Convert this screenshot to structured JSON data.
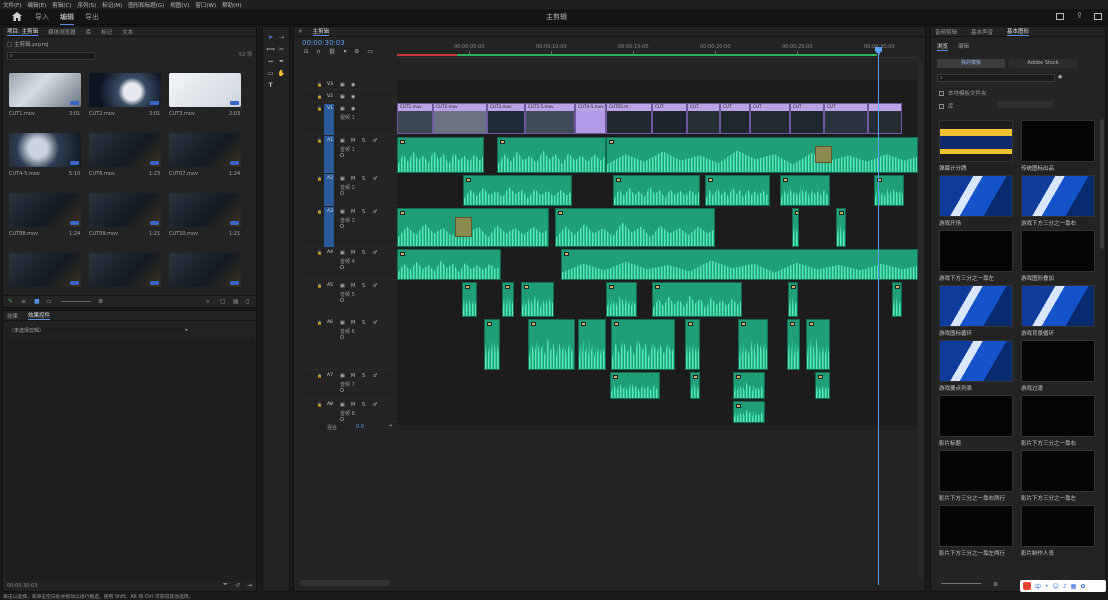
{
  "menu": [
    "文件(F)",
    "编辑(E)",
    "剪辑(C)",
    "序列(S)",
    "标记(M)",
    "图形和标题(G)",
    "视图(V)",
    "窗口(W)",
    "帮助(H)"
  ],
  "workspace": {
    "tabs": [
      "导入",
      "编辑",
      "导出"
    ],
    "active": "编辑",
    "title": "主剪辑"
  },
  "project": {
    "tabs": [
      "项目: 主剪辑",
      "媒体浏览器",
      "库",
      "标记",
      "文本"
    ],
    "file": "主剪辑.prproj",
    "count": "52 项",
    "clips": [
      {
        "name": "CUT1.mov",
        "dur": "3:01",
        "tone": "lightgear"
      },
      {
        "name": "CUT2.mov",
        "dur": "3:01",
        "tone": "globe"
      },
      {
        "name": "CUT3.mov",
        "dur": "2:03",
        "tone": "white"
      },
      {
        "name": "CUT4-5.mov",
        "dur": "5:10",
        "tone": "gear"
      },
      {
        "name": "CUT6.mov",
        "dur": "1:23",
        "tone": "dark"
      },
      {
        "name": "CUT07.mov",
        "dur": "1:24",
        "tone": "dark"
      },
      {
        "name": "CUT08.mov",
        "dur": "1:24",
        "tone": "dark"
      },
      {
        "name": "CUT09.mov",
        "dur": "1:21",
        "tone": "dark"
      },
      {
        "name": "CUT10.mov",
        "dur": "1:21",
        "tone": "dark"
      },
      {
        "name": "",
        "dur": "",
        "tone": "dark"
      },
      {
        "name": "",
        "dur": "",
        "tone": "dark"
      },
      {
        "name": "",
        "dur": "",
        "tone": "dark"
      }
    ]
  },
  "effects": {
    "tabs": [
      "效果",
      "效果控件"
    ],
    "clip_selector": "（未选择剪辑）",
    "timecode": "00:00:30:03"
  },
  "timeline": {
    "tab": "主剪辑",
    "timecode": "00:00:30:03",
    "ruler": [
      "00:00:05:00",
      "00:00:10:00",
      "00:00:15:00",
      "00:00:20:00",
      "00:00:25:00",
      "00:00:30:00"
    ],
    "tracks": {
      "v": [
        {
          "id": "V3"
        },
        {
          "id": "V2"
        },
        {
          "id": "V1",
          "name": "视频 1"
        }
      ],
      "a": [
        {
          "id": "A1",
          "name": "音频 1"
        },
        {
          "id": "A2",
          "name": "音频 2"
        },
        {
          "id": "A3",
          "name": "音频 3"
        },
        {
          "id": "A4",
          "name": "音频 4"
        },
        {
          "id": "A5",
          "name": "音频 5"
        },
        {
          "id": "A6",
          "name": "音频 6"
        },
        {
          "id": "A7",
          "name": "音频 7"
        },
        {
          "id": "A8",
          "name": "音频 8"
        }
      ],
      "mix": "混合",
      "mix_val": "0.0",
      "m": "M",
      "s": "S",
      "o": "O"
    },
    "vclips": [
      "CUT1.mov",
      "CUT2.mov",
      "CUT3.mov",
      "CUT3 5.mov",
      "CUT4-5.mov",
      "CUT05.m",
      "CUT",
      "CUT",
      "CUT",
      "CUT",
      "CUT",
      "CUT"
    ]
  },
  "graphics": {
    "tabs": [
      "音频剪辑",
      "基本声音",
      "基本图形"
    ],
    "subtabs": [
      "浏览",
      "编辑"
    ],
    "sources": [
      "我的模板",
      "Adobe Stock"
    ],
    "opt1": "本地模板文件夹",
    "opt2": "库",
    "templates": [
      {
        "name": "弹幕计分牌",
        "tone": "yellow"
      },
      {
        "name": "传统图标出品",
        "tone": "black"
      },
      {
        "name": "游戏开场",
        "tone": "blue"
      },
      {
        "name": "游戏下方三分之一靠右",
        "tone": "blue"
      },
      {
        "name": "游戏下方三分之一靠左",
        "tone": "black"
      },
      {
        "name": "游戏图形叠加",
        "tone": "black"
      },
      {
        "name": "游戏图标循环",
        "tone": "blue"
      },
      {
        "name": "游戏背景循环",
        "tone": "blue"
      },
      {
        "name": "游戏要点列表",
        "tone": "blue"
      },
      {
        "name": "游戏过渡",
        "tone": "black"
      },
      {
        "name": "影片标题",
        "tone": "black"
      },
      {
        "name": "影片下方三分之一靠右",
        "tone": "black"
      },
      {
        "name": "影片下方三分之一靠右两行",
        "tone": "black"
      },
      {
        "name": "影片下方三分之一靠左",
        "tone": "black"
      },
      {
        "name": "影片下方三分之一靠左两行",
        "tone": "black"
      },
      {
        "name": "影片制作人员",
        "tone": "black"
      }
    ]
  },
  "status": "单击以选择，或单击空白处并拖动以进行框选。使用 Shift、Alt 和 Ctrl 可获得其他选项。",
  "colors": {
    "accent": "#5b8fe6",
    "audio": "#1f9e77",
    "video": "#9b82c9",
    "playhead": "#5aa0ff"
  }
}
